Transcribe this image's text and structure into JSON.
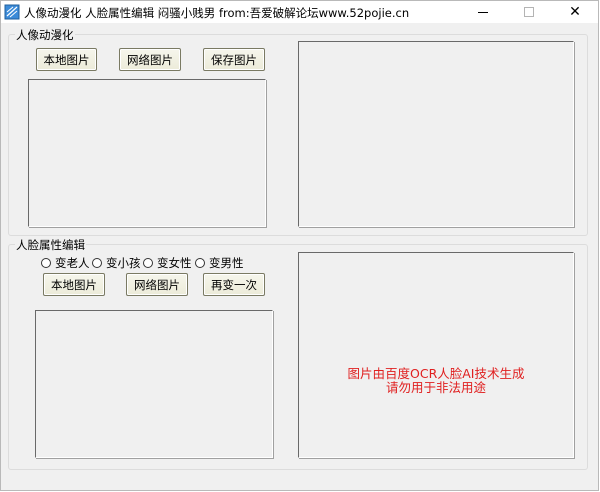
{
  "window": {
    "title": "人像动漫化 人脸属性编辑 闷骚小贱男 from:吾爱破解论坛www.52pojie.cn",
    "close_glyph": "✕"
  },
  "anime_group": {
    "legend": "人像动漫化",
    "buttons": {
      "local": "本地图片",
      "network": "网络图片",
      "save": "保存图片"
    }
  },
  "face_group": {
    "legend": "人脸属性编辑",
    "radios": [
      "变老人",
      "变小孩",
      "变女性",
      "变男性"
    ],
    "buttons": {
      "local": "本地图片",
      "network": "网络图片",
      "again": "再变一次"
    },
    "notice_line1": "图片由百度OCR人脸AI技术生成",
    "notice_line2": "请勿用于非法用途"
  },
  "colors": {
    "notice": "#e02020",
    "window_bg": "#f0f0f0"
  },
  "icons": [
    "app-icon",
    "minimize-icon",
    "maximize-icon",
    "close-icon"
  ]
}
